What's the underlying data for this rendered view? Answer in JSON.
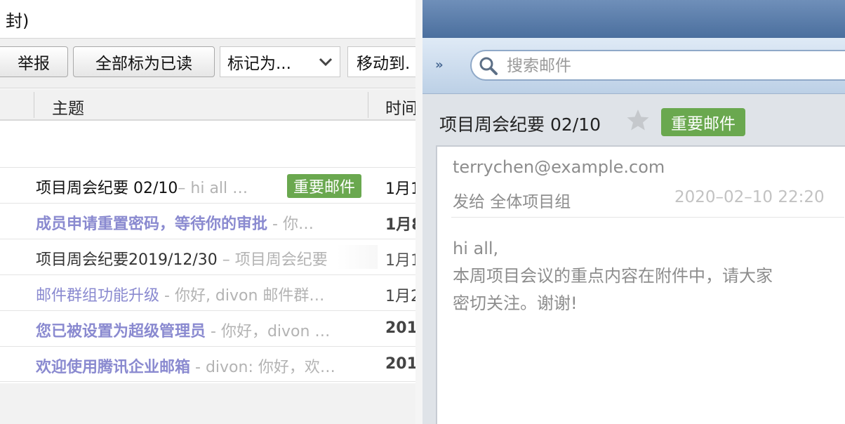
{
  "left": {
    "title": "封)",
    "toolbar": {
      "report": "举报",
      "mark_all_read": "全部标为已读",
      "mark_as": "标记为...",
      "move_to": "移动到."
    },
    "columns": {
      "subject": "主题",
      "time": "时间"
    },
    "rows": [
      {
        "subject": "项目周会纪要 02/10",
        "snippet": "– hi all …",
        "tag": "重要邮件",
        "time": "1月1"
      },
      {
        "subject": "成员申请重置密码，等待你的审批",
        "snippet": " - 你…",
        "time": "1月8"
      },
      {
        "subject": "项目周会纪要2019/12/30",
        "snippet": " – 项目周会纪要",
        "time": "1月1"
      },
      {
        "subject": "邮件群组功能升级",
        "snippet": " - 你好, divon 邮件群…",
        "time": "1月2"
      },
      {
        "subject": "您已被设置为超级管理员",
        "snippet": " - 你好，divon …",
        "time": "201"
      },
      {
        "subject": "欢迎使用腾讯企业邮箱",
        "snippet": " - divon: 你好，欢…",
        "time": "201"
      }
    ]
  },
  "right": {
    "search": {
      "placeholder": "搜索邮件",
      "value": ""
    },
    "expand_icon": "»",
    "subject": "项目周会纪要 02/10",
    "tag": "重要邮件",
    "sender": "terrychen@example.com",
    "to": "发给  全体项目组",
    "date": "2020–02–10 22:20",
    "body": {
      "line1": "hi all,",
      "line2": "本周项目会议的重点内容在附件中，请大家",
      "line3": "密切关注。谢谢!"
    }
  },
  "colors": {
    "tag_green": "#6aa84f",
    "unread_subject": "#8a8ad0",
    "titlebar_blue": "#4b6f9e"
  },
  "icons": [
    "chevron-down-icon",
    "search-icon",
    "star-icon",
    "expand-icon"
  ]
}
